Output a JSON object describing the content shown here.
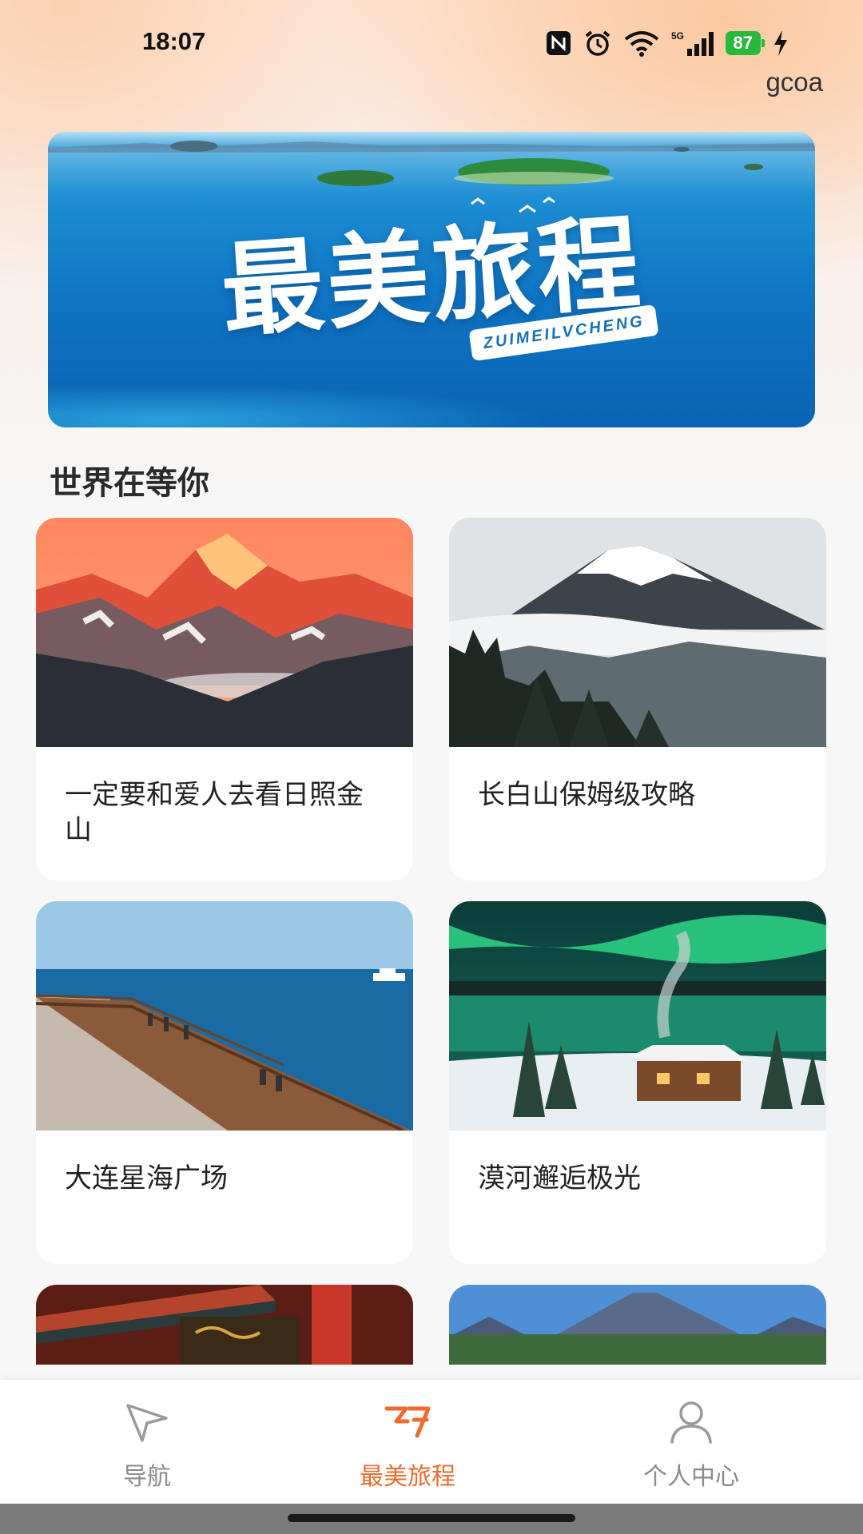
{
  "status_bar": {
    "time": "18:07",
    "battery": "87",
    "network": "5G"
  },
  "header": {
    "user_code": "gcoa"
  },
  "banner": {
    "title": "最美旅程",
    "subtitle": "ZUIMEILVCHENG"
  },
  "section": {
    "title": "世界在等你"
  },
  "cards": [
    {
      "title": "一定要和爱人去看日照金山",
      "scene": "sunset-snow-mountain"
    },
    {
      "title": "长白山保姆级攻略",
      "scene": "snow-mountain-clouds"
    },
    {
      "title": "大连星海广场",
      "scene": "seaside-boardwalk"
    },
    {
      "title": "漠河邂逅极光",
      "scene": "aurora-cabin"
    },
    {
      "title": "",
      "scene": "palace-eaves"
    },
    {
      "title": "",
      "scene": "volcano-blue-sky"
    }
  ],
  "bottom_nav": {
    "items": [
      {
        "label": "导航",
        "icon": "navigation-arrow-icon",
        "active": false
      },
      {
        "label": "最美旅程",
        "icon": "journey-flag-icon",
        "active": true
      },
      {
        "label": "个人中心",
        "icon": "user-profile-icon",
        "active": false
      }
    ]
  },
  "colors": {
    "accent": "#ee6b2d",
    "inactive": "#8b8b8b",
    "battery": "#2ab83a"
  }
}
